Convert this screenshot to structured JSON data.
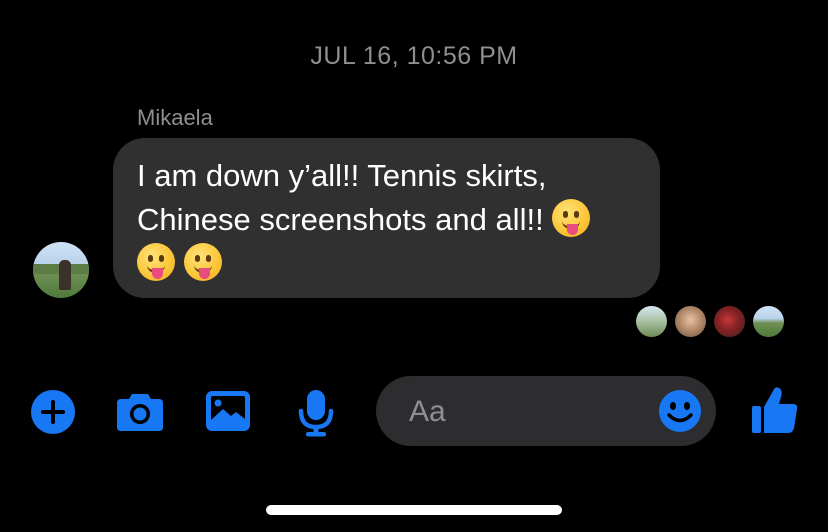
{
  "thread": {
    "timestamp": "JUL 16, 10:56 PM",
    "message": {
      "sender": "Mikaela",
      "text_line1": "I am down y’all!! Tennis skirts,",
      "text_line2": "Chinese screenshots and all!!",
      "emoji": "😛",
      "emoji_count": 3
    },
    "read_receipts_count": 4
  },
  "composer": {
    "placeholder": "Aa"
  },
  "toolbar": {
    "icons": [
      "plus-icon",
      "camera-icon",
      "gallery-icon",
      "microphone-icon",
      "emoji-icon",
      "thumbs-up-icon"
    ]
  },
  "colors": {
    "background": "#000000",
    "accent": "#1877f2",
    "bubble": "#303030",
    "secondary_text": "#8e8e93"
  }
}
